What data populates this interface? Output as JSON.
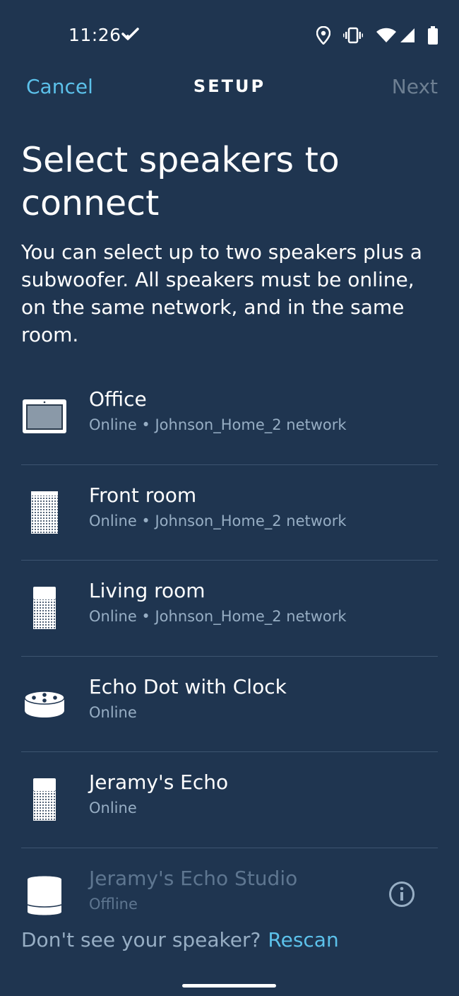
{
  "status": {
    "time": "11:26",
    "icons": [
      "check-icon",
      "location-icon",
      "vibrate-icon",
      "wifi-icon",
      "signal-icon",
      "battery-icon"
    ]
  },
  "nav": {
    "cancel": "Cancel",
    "title": "SETUP",
    "next": "Next"
  },
  "heading": "Select speakers to connect",
  "description": "You can select up to two speakers plus a subwoofer. All speakers must be online, on the same network, and in the same room.",
  "devices": [
    {
      "name": "Office",
      "status": "Online • Johnson_Home_2 network",
      "icon": "echo-show-icon"
    },
    {
      "name": "Front room",
      "status": "Online • Johnson_Home_2 network",
      "icon": "echo-speaker-icon"
    },
    {
      "name": "Living room",
      "status": "Online • Johnson_Home_2 network",
      "icon": "echo-speaker-icon"
    },
    {
      "name": "Echo Dot with Clock",
      "status": "Online",
      "icon": "echo-dot-icon"
    },
    {
      "name": "Jeramy's Echo",
      "status": "Online",
      "icon": "echo-speaker-icon"
    },
    {
      "name": "Jeramy's Echo Studio",
      "status": "Offline",
      "icon": "echo-studio-icon"
    }
  ],
  "footer": {
    "text": "Don't see your speaker?",
    "link": "Rescan"
  },
  "colors": {
    "background": "#1f3550",
    "accent": "#5cc1ea",
    "muted": "#97aec4",
    "disabled": "#6d7f92"
  }
}
